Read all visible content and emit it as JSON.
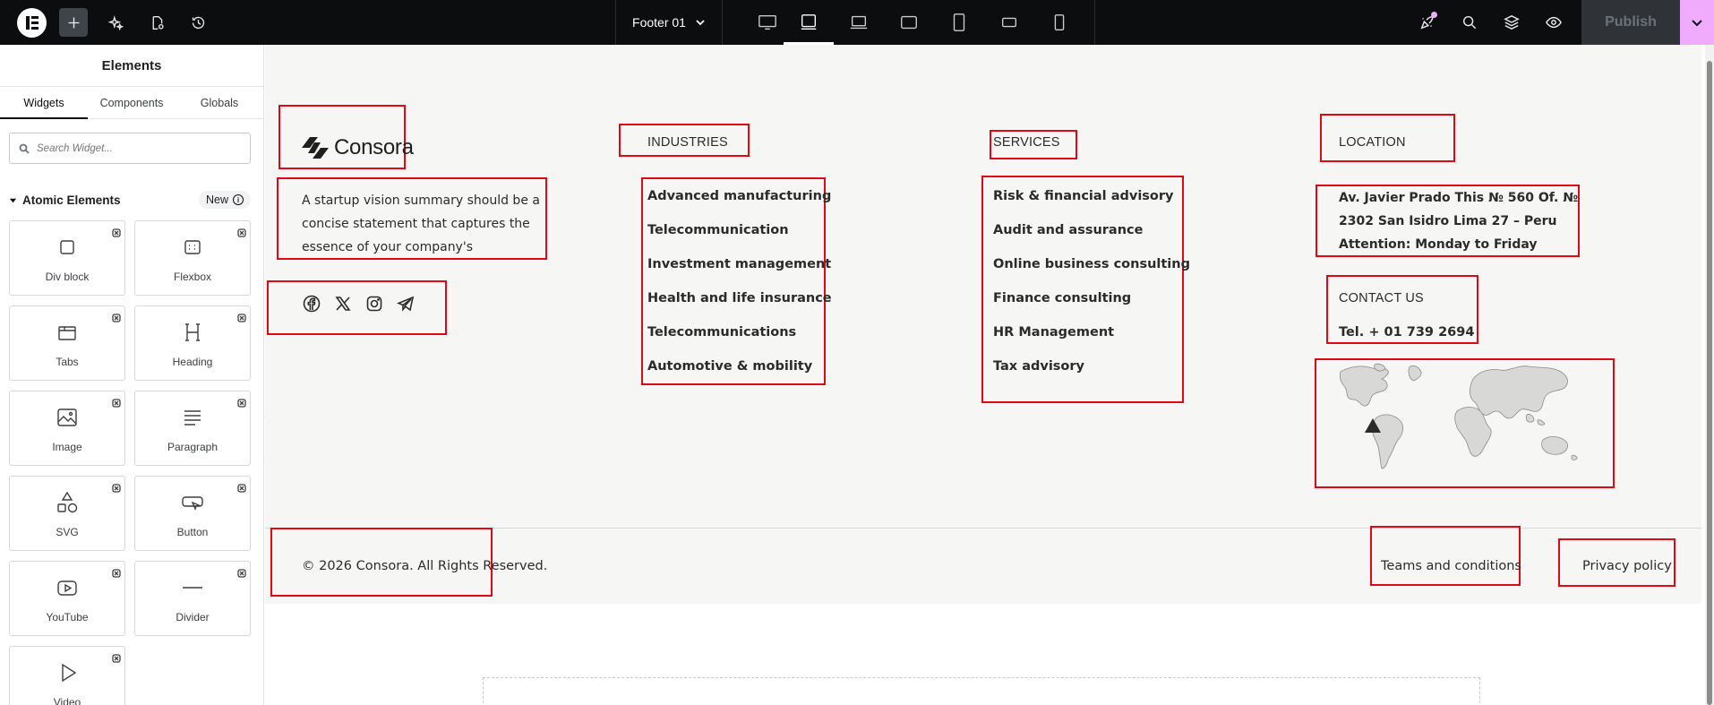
{
  "topbar": {
    "document_name": "Footer 01",
    "publish_label": "Publish",
    "icons": [
      "elementor-logo-icon",
      "add-icon",
      "ai-sparkle-icon",
      "page-settings-icon",
      "history-icon",
      "notifications-icon",
      "search-icon",
      "structure-layers-icon",
      "preview-eye-icon",
      "chevron-down-icon"
    ],
    "devices": [
      "desktop",
      "tablet-landscape",
      "laptop",
      "tablet-extra",
      "tablet-portrait",
      "mobile-landscape",
      "mobile"
    ],
    "active_device": "tablet-landscape",
    "accent_color": "#f0abfc"
  },
  "panel": {
    "title": "Elements",
    "tabs": [
      {
        "label": "Widgets",
        "active": true
      },
      {
        "label": "Components",
        "active": false
      },
      {
        "label": "Globals",
        "active": false
      }
    ],
    "search_placeholder": "Search Widget...",
    "category": {
      "label": "Atomic Elements",
      "badge": "New"
    },
    "widgets": [
      {
        "label": "Div block",
        "icon": "div-block-icon"
      },
      {
        "label": "Flexbox",
        "icon": "flexbox-icon"
      },
      {
        "label": "Tabs",
        "icon": "tabs-icon"
      },
      {
        "label": "Heading",
        "icon": "heading-icon"
      },
      {
        "label": "Image",
        "icon": "image-icon"
      },
      {
        "label": "Paragraph",
        "icon": "paragraph-icon"
      },
      {
        "label": "SVG",
        "icon": "svg-icon"
      },
      {
        "label": "Button",
        "icon": "button-icon"
      },
      {
        "label": "YouTube",
        "icon": "youtube-icon"
      },
      {
        "label": "Divider",
        "icon": "divider-icon"
      },
      {
        "label": "Video",
        "icon": "video-icon"
      }
    ]
  },
  "footer": {
    "brand": "Consora",
    "about": "A startup vision summary should be a concise statement that captures the essence of your company's",
    "social_icons": [
      "facebook-icon",
      "x-icon",
      "instagram-icon",
      "telegram-icon"
    ],
    "industries": {
      "heading": "INDUSTRIES",
      "items": [
        "Advanced manufacturing",
        "Telecommunication",
        "Investment management",
        "Health and life insurance",
        "Telecommunications",
        "Automotive & mobility"
      ]
    },
    "services": {
      "heading": "SERVICES",
      "items": [
        "Risk & financial advisory",
        "Audit and assurance",
        "Online business consulting",
        "Finance consulting",
        "HR Management",
        "Tax advisory"
      ]
    },
    "location": {
      "heading": "LOCATION",
      "lines": [
        "Av. Javier Prado This № 560 Of. №",
        "2302 San Isidro Lima 27 – Peru",
        "Attention: Monday to Friday"
      ]
    },
    "contact": {
      "heading": "CONTACT US",
      "phone": "Tel. + 01 739 2694"
    },
    "copyright": "© 2026 Consora. All Rights Reserved.",
    "terms_label": "Teams and conditions",
    "privacy_label": "Privacy policy",
    "selection_color": "#e30613"
  }
}
